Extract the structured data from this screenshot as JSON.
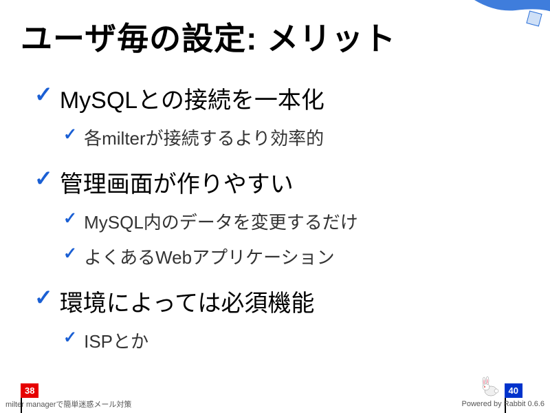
{
  "title": "ユーザ毎の設定: メリット",
  "bullets": [
    {
      "level": 1,
      "text": "MySQLとの接続を一本化"
    },
    {
      "level": 2,
      "text": "各milterが接続するより効率的"
    },
    {
      "level": 1,
      "text": "管理画面が作りやすい"
    },
    {
      "level": 2,
      "text": "MySQL内のデータを変更するだけ"
    },
    {
      "level": 2,
      "text": "よくあるWebアプリケーション"
    },
    {
      "level": 1,
      "text": "環境によっては必須機能"
    },
    {
      "level": 2,
      "text": "ISPとか"
    }
  ],
  "flags": {
    "current": "38",
    "total": "40"
  },
  "footer": {
    "left": "milter managerで簡単迷惑メール対策",
    "right": "Powered by Rabbit 0.6.6"
  }
}
